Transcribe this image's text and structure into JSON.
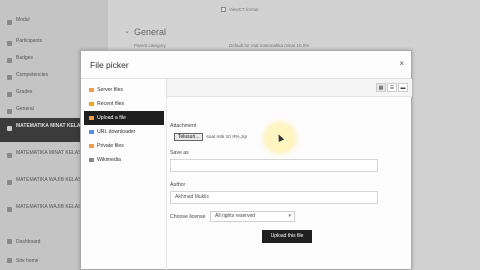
{
  "sidebar": {
    "items": [
      {
        "label": "Modul"
      },
      {
        "label": "Participants"
      },
      {
        "label": "Badges"
      },
      {
        "label": "Competencies"
      },
      {
        "label": "Grades"
      },
      {
        "label": "General"
      },
      {
        "label": "MATEMATIKA MINAT KELAS 10"
      },
      {
        "label": "MATEMATIKA MINAT KELAS 11"
      },
      {
        "label": "MATEMATIKA WAJIB KELAS 10"
      },
      {
        "label": "MATEMATIKA WAJIB KELAS 11"
      }
    ],
    "bottom": [
      {
        "label": "Dashboard"
      },
      {
        "label": "Site home"
      }
    ]
  },
  "background": {
    "section_title": "General",
    "top_option": "ViewCT format",
    "course_category_label": "Parent category",
    "course_category_value": "Default for mat matematika minat 10.0%"
  },
  "modal": {
    "title": "File picker",
    "close": "×",
    "nav": [
      {
        "label": "Server files",
        "color": "#e8a33a"
      },
      {
        "label": "Recent files",
        "color": "#e8a33a"
      },
      {
        "label": "Upload a file",
        "color": "#e8a33a"
      },
      {
        "label": "URL downloader",
        "color": "#5b8fd6"
      },
      {
        "label": "Private files",
        "color": "#e8a33a"
      },
      {
        "label": "Wikimedia",
        "color": "#888888"
      }
    ],
    "selected_nav": "Upload a file",
    "view_buttons": [
      "▦",
      "☰",
      "▬"
    ],
    "attachment_label": "Attachment",
    "file_button": "Telusuri...",
    "file_name": "soal mtk 10 IPA.zip",
    "save_as_label": "Save as",
    "save_as_value": "",
    "author_label": "Author",
    "author_value": "Akhmad Muklis",
    "license_label": "Choose license",
    "license_value": "All rights reserved",
    "upload_button": "Upload this file"
  }
}
